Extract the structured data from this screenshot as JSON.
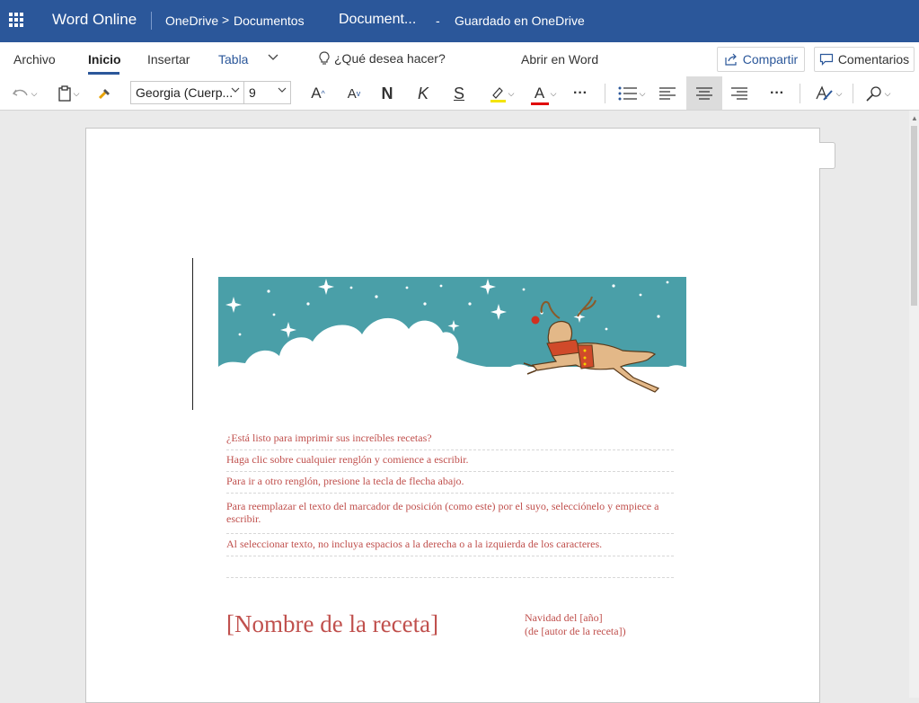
{
  "app": {
    "name": "Word Online",
    "breadcrumb": [
      "OneDrive",
      "Documentos"
    ],
    "document_title": "Document...",
    "separator": "-",
    "save_status": "Guardado en OneDrive"
  },
  "ribbon": {
    "tabs": [
      "Archivo",
      "Inicio",
      "Insertar",
      "Tabla"
    ],
    "active_tab": "Inicio",
    "tell_me": "¿Qué desea hacer?",
    "open_in_word": "Abrir en Word",
    "share_label": "Compartir",
    "comments_label": "Comentarios"
  },
  "toolbar": {
    "font_name": "Georgia (Cuerp...",
    "font_size": "9",
    "bold_glyph": "N",
    "italic_glyph": "K",
    "strike_glyph": "S",
    "font_color_glyph": "A",
    "grow_glyph": "A",
    "shrink_glyph": "A",
    "more_glyph": "···",
    "highlight_color": "#f4e400",
    "font_color": "#e00000",
    "active_alignment": "center"
  },
  "document": {
    "instructions": [
      "¿Está listo para imprimir sus increíbles recetas?",
      "Haga clic sobre cualquier renglón y comience a escribir.",
      "Para ir a otro renglón, presione la tecla de flecha abajo.",
      "Para reemplazar el texto del marcador de posición (como este) por el suyo, selecciónelo y empiece a escribir.",
      "Al seleccionar texto, no incluya espacios a la derecha o a la izquierda de los caracteres."
    ],
    "recipe_name": "[Nombre de la receta]",
    "recipe_meta_line1": "Navidad del [año]",
    "recipe_meta_line2": "(de [autor de la receta])",
    "accent_color": "#c0504d",
    "banner_bg": "#4a9fa8"
  }
}
